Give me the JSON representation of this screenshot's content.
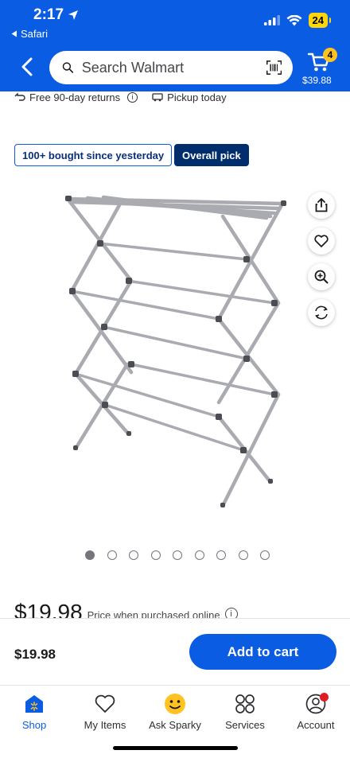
{
  "status": {
    "time": "2:17",
    "back_app": "Safari",
    "battery": "24"
  },
  "header": {
    "search_placeholder": "Search Walmart",
    "cart_count": "4",
    "cart_total": "$39.88"
  },
  "info_strip": {
    "returns": "Free 90-day returns",
    "pickup": "Pickup today"
  },
  "badges": {
    "bought": "100+ bought since yesterday",
    "pick": "Overall pick"
  },
  "carousel": {
    "total_images": 9,
    "active_index": 0
  },
  "price": {
    "amount": "$19.98",
    "note": "Price when purchased online",
    "info": "i"
  },
  "add_bar": {
    "price": "$19.98",
    "button": "Add to cart"
  },
  "nav": {
    "items": [
      {
        "label": "Shop",
        "icon": "shop-icon",
        "active": true
      },
      {
        "label": "My Items",
        "icon": "heart-icon"
      },
      {
        "label": "Ask Sparky",
        "icon": "sparky-icon"
      },
      {
        "label": "Services",
        "icon": "services-icon"
      },
      {
        "label": "Account",
        "icon": "account-icon"
      }
    ]
  },
  "colors": {
    "brand_blue": "#0a5ce3",
    "navy": "#002d6b",
    "yellow": "#ffc220"
  }
}
